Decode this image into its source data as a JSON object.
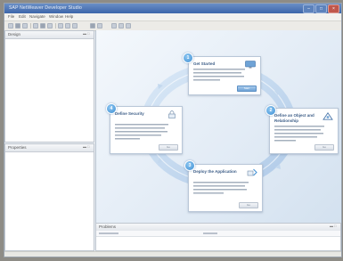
{
  "window": {
    "title": "SAP NetWeaver Developer Studio",
    "controls": [
      "–",
      "□",
      "×"
    ]
  },
  "menubar": {
    "items": [
      "File",
      "Edit",
      "Navigate",
      "Window",
      "Help"
    ]
  },
  "left_panel_top": {
    "tab_label": "Design"
  },
  "left_panel_bottom": {
    "tab_label": "Properties"
  },
  "welcome": {
    "cards": [
      {
        "num": "1",
        "title": "Get Started",
        "icon": "monitor-icon",
        "button": "Start",
        "primary": true
      },
      {
        "num": "2",
        "title": "Define an Object and Relationship",
        "icon": "objects-icon",
        "button": "Go",
        "primary": false
      },
      {
        "num": "3",
        "title": "Deploy the Application",
        "icon": "deploy-icon",
        "button": "Go",
        "primary": false
      },
      {
        "num": "4",
        "title": "Define Security",
        "icon": "security-icon",
        "button": "Go",
        "primary": false
      }
    ]
  },
  "problems": {
    "tab_label": "Problems"
  },
  "colors": {
    "accent": "#3d8ed3",
    "ring": "#bcd4ec",
    "titlebar": "#3d66aa"
  }
}
